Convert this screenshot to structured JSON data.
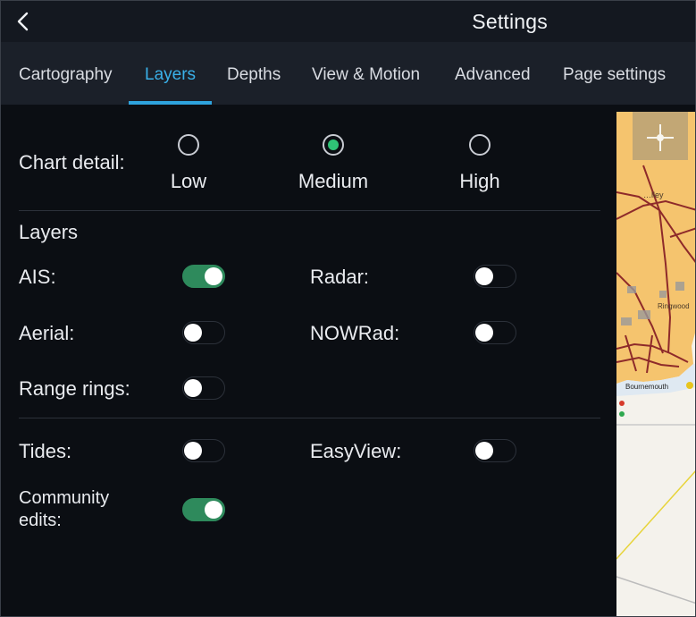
{
  "header": {
    "title": "Settings",
    "back_icon": "chevron-left-icon"
  },
  "tabs": [
    {
      "label": "Cartography",
      "active": false
    },
    {
      "label": "Layers",
      "active": true
    },
    {
      "label": "Depths",
      "active": false
    },
    {
      "label": "View & Motion",
      "active": false
    },
    {
      "label": "Advanced",
      "active": false
    },
    {
      "label": "Page settings",
      "active": false
    }
  ],
  "chart_detail": {
    "label": "Chart detail:",
    "options": [
      "Low",
      "Medium",
      "High"
    ],
    "selected": "Medium"
  },
  "layers": {
    "heading": "Layers",
    "ais": {
      "label": "AIS:",
      "on": true
    },
    "radar": {
      "label": "Radar:",
      "on": false
    },
    "aerial": {
      "label": "Aerial:",
      "on": false
    },
    "nowrad": {
      "label": "NOWRad:",
      "on": false
    },
    "range_rings": {
      "label": "Range rings:",
      "on": false
    }
  },
  "extras": {
    "tides": {
      "label": "Tides:",
      "on": false
    },
    "easyview": {
      "label": "EasyView:",
      "on": false
    },
    "community": {
      "label_line1": "Community",
      "label_line2": "edits:",
      "on": true
    }
  },
  "map": {
    "place_1": "…lley",
    "place_2": "Ringwood",
    "place_3": "Bournemouth"
  },
  "colors": {
    "accent": "#2ea3dd",
    "toggle_on": "#2e8a5c",
    "radio_selected": "#2fc276",
    "land": "#f5c46e"
  }
}
